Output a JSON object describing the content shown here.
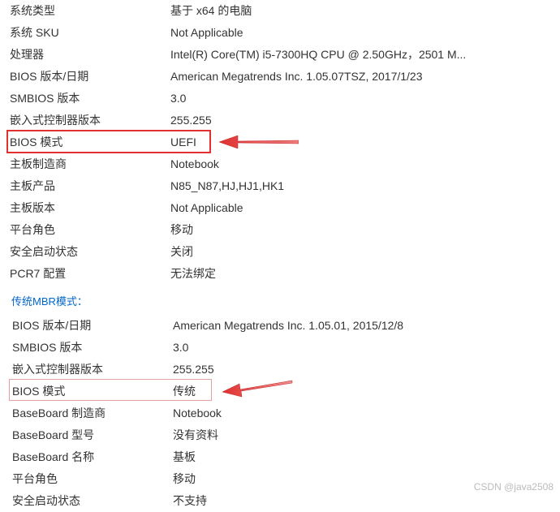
{
  "section1": {
    "rows": [
      {
        "label": "系统类型",
        "value": "基于 x64 的电脑"
      },
      {
        "label": "系统 SKU",
        "value": "Not Applicable"
      },
      {
        "label": "处理器",
        "value": "Intel(R) Core(TM) i5-7300HQ CPU @ 2.50GHz，2501 M..."
      },
      {
        "label": "BIOS 版本/日期",
        "value": "American Megatrends Inc. 1.05.07TSZ, 2017/1/23"
      },
      {
        "label": "SMBIOS 版本",
        "value": "3.0"
      },
      {
        "label": "嵌入式控制器版本",
        "value": "255.255"
      },
      {
        "label": "BIOS 模式",
        "value": "UEFI"
      },
      {
        "label": "主板制造商",
        "value": "Notebook"
      },
      {
        "label": "主板产品",
        "value": "N85_N87,HJ,HJ1,HK1"
      },
      {
        "label": "主板版本",
        "value": "Not Applicable"
      },
      {
        "label": "平台角色",
        "value": "移动"
      },
      {
        "label": "安全启动状态",
        "value": "关闭"
      },
      {
        "label": "PCR7 配置",
        "value": "无法绑定"
      }
    ]
  },
  "section2": {
    "title": "传统MBR模式：",
    "rows": [
      {
        "label": "BIOS 版本/日期",
        "value": "American Megatrends Inc. 1.05.01, 2015/12/8"
      },
      {
        "label": "SMBIOS 版本",
        "value": "3.0"
      },
      {
        "label": "嵌入式控制器版本",
        "value": "255.255"
      },
      {
        "label": "BIOS 模式",
        "value": "传统"
      },
      {
        "label": "BaseBoard 制造商",
        "value": "Notebook"
      },
      {
        "label": "BaseBoard 型号",
        "value": "没有资料"
      },
      {
        "label": "BaseBoard 名称",
        "value": "基板"
      },
      {
        "label": "平台角色",
        "value": "移动"
      },
      {
        "label": "安全启动状态",
        "value": "不支持"
      }
    ]
  },
  "watermark": "CSDN @java2508"
}
